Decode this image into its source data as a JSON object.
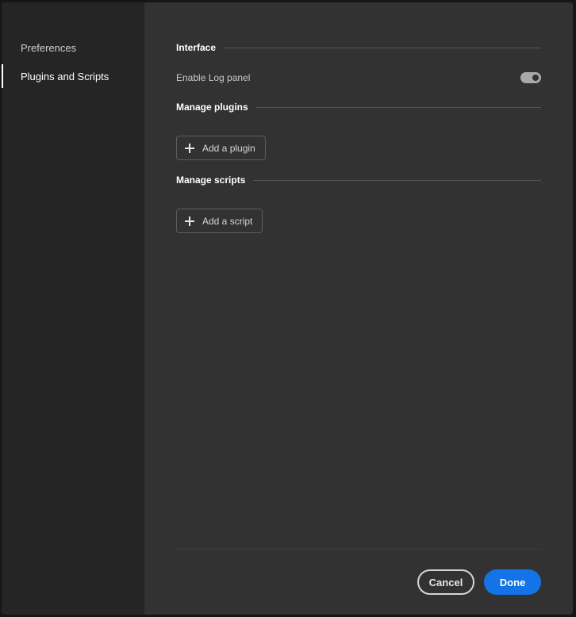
{
  "sidebar": {
    "items": [
      {
        "label": "Preferences",
        "selected": false
      },
      {
        "label": "Plugins and Scripts",
        "selected": true
      }
    ]
  },
  "sections": {
    "interface": {
      "title": "Interface",
      "log_panel_label": "Enable Log panel",
      "log_panel_enabled": true
    },
    "plugins": {
      "title": "Manage plugins",
      "add_label": "Add a plugin"
    },
    "scripts": {
      "title": "Manage scripts",
      "add_label": "Add a script"
    }
  },
  "footer": {
    "cancel_label": "Cancel",
    "done_label": "Done"
  },
  "colors": {
    "accent": "#1473e6",
    "panel": "#323232",
    "sidebar": "#252525"
  },
  "icons": [
    "plus-icon"
  ]
}
